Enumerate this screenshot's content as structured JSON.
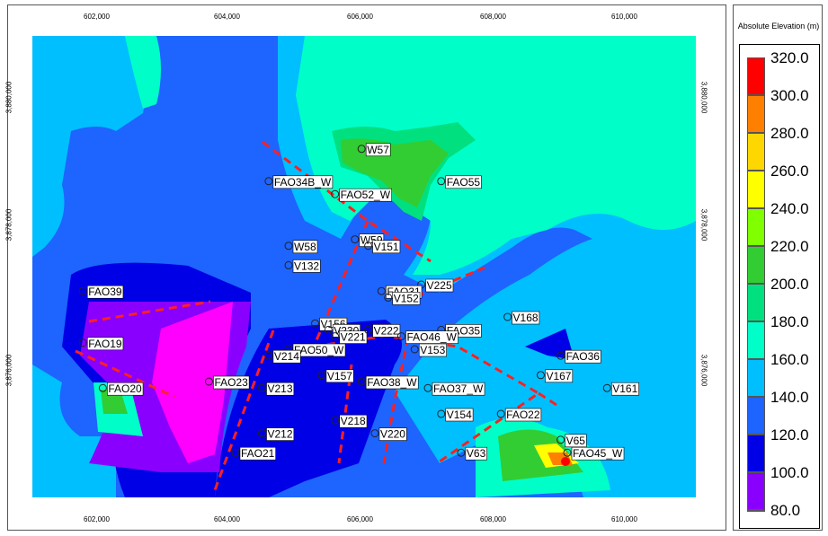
{
  "legend": {
    "title": "Absolute Elevation (m)",
    "items": [
      {
        "label": "320.0",
        "color": "#ff0000"
      },
      {
        "label": "300.0",
        "color": "#ff7f00"
      },
      {
        "label": "280.0",
        "color": "#ffd700"
      },
      {
        "label": "260.0",
        "color": "#ffff00"
      },
      {
        "label": "240.0",
        "color": "#7fff00"
      },
      {
        "label": "220.0",
        "color": "#32cd32"
      },
      {
        "label": "200.0",
        "color": "#00e07f"
      },
      {
        "label": "180.0",
        "color": "#00ffc8"
      },
      {
        "label": "160.0",
        "color": "#00bfff"
      },
      {
        "label": "140.0",
        "color": "#1e64ff"
      },
      {
        "label": "120.0",
        "color": "#0000e6"
      },
      {
        "label": "100.0",
        "color": "#8a00ff"
      },
      {
        "label": "80.0",
        "color": "#ff00ff"
      }
    ]
  },
  "axes": {
    "x_ticks": [
      "602,000",
      "604,000",
      "606,000",
      "608,000",
      "610,000"
    ],
    "y_ticks": [
      "3,880,000",
      "3,878,000",
      "3,876,000"
    ]
  },
  "wells": [
    {
      "name": "W57",
      "x": 606,
      "y": 3879.1
    },
    {
      "name": "FAO34B_W",
      "x": 604.6,
      "y": 3878.6
    },
    {
      "name": "FAO52_W",
      "x": 605.6,
      "y": 3878.4
    },
    {
      "name": "FAO55",
      "x": 607.2,
      "y": 3878.6
    },
    {
      "name": "W59",
      "x": 605.9,
      "y": 3877.7
    },
    {
      "name": "W58",
      "x": 604.9,
      "y": 3877.6
    },
    {
      "name": "V151",
      "x": 606.1,
      "y": 3877.6
    },
    {
      "name": "V132",
      "x": 604.9,
      "y": 3877.3
    },
    {
      "name": "FAO39",
      "x": 601.8,
      "y": 3876.9
    },
    {
      "name": "V225",
      "x": 606.9,
      "y": 3877.0
    },
    {
      "name": "FAO31",
      "x": 606.3,
      "y": 3876.9
    },
    {
      "name": "V152",
      "x": 606.4,
      "y": 3876.8
    },
    {
      "name": "V168",
      "x": 608.2,
      "y": 3876.5
    },
    {
      "name": "V156",
      "x": 605.3,
      "y": 3876.4
    },
    {
      "name": "V230",
      "x": 605.5,
      "y": 3876.3
    },
    {
      "name": "V221",
      "x": 605.6,
      "y": 3876.2
    },
    {
      "name": "V222",
      "x": 606.1,
      "y": 3876.3
    },
    {
      "name": "FAO35",
      "x": 607.2,
      "y": 3876.3
    },
    {
      "name": "FAO46_W",
      "x": 606.6,
      "y": 3876.2
    },
    {
      "name": "FAO19",
      "x": 601.8,
      "y": 3876.1
    },
    {
      "name": "FAO50_W",
      "x": 604.9,
      "y": 3876.0
    },
    {
      "name": "V153",
      "x": 606.8,
      "y": 3876.0
    },
    {
      "name": "V214",
      "x": 604.6,
      "y": 3875.9
    },
    {
      "name": "FAO36",
      "x": 609.0,
      "y": 3875.9
    },
    {
      "name": "FAO23",
      "x": 603.7,
      "y": 3875.5
    },
    {
      "name": "V157",
      "x": 605.4,
      "y": 3875.6
    },
    {
      "name": "FAO38_W",
      "x": 606.0,
      "y": 3875.5
    },
    {
      "name": "V167",
      "x": 608.7,
      "y": 3875.6
    },
    {
      "name": "FAO20",
      "x": 602.1,
      "y": 3875.4
    },
    {
      "name": "V213",
      "x": 604.5,
      "y": 3875.4
    },
    {
      "name": "FAO37_W",
      "x": 607.0,
      "y": 3875.4
    },
    {
      "name": "V161",
      "x": 609.7,
      "y": 3875.4
    },
    {
      "name": "V154",
      "x": 607.2,
      "y": 3875.0
    },
    {
      "name": "FAO22",
      "x": 608.1,
      "y": 3875.0
    },
    {
      "name": "V218",
      "x": 605.6,
      "y": 3874.9
    },
    {
      "name": "V212",
      "x": 604.5,
      "y": 3874.7
    },
    {
      "name": "V220",
      "x": 606.2,
      "y": 3874.7
    },
    {
      "name": "V65",
      "x": 609.0,
      "y": 3874.6
    },
    {
      "name": "FAO21",
      "x": 604.1,
      "y": 3874.4
    },
    {
      "name": "V63",
      "x": 607.5,
      "y": 3874.4
    },
    {
      "name": "FAO45_W",
      "x": 609.1,
      "y": 3874.4
    }
  ]
}
